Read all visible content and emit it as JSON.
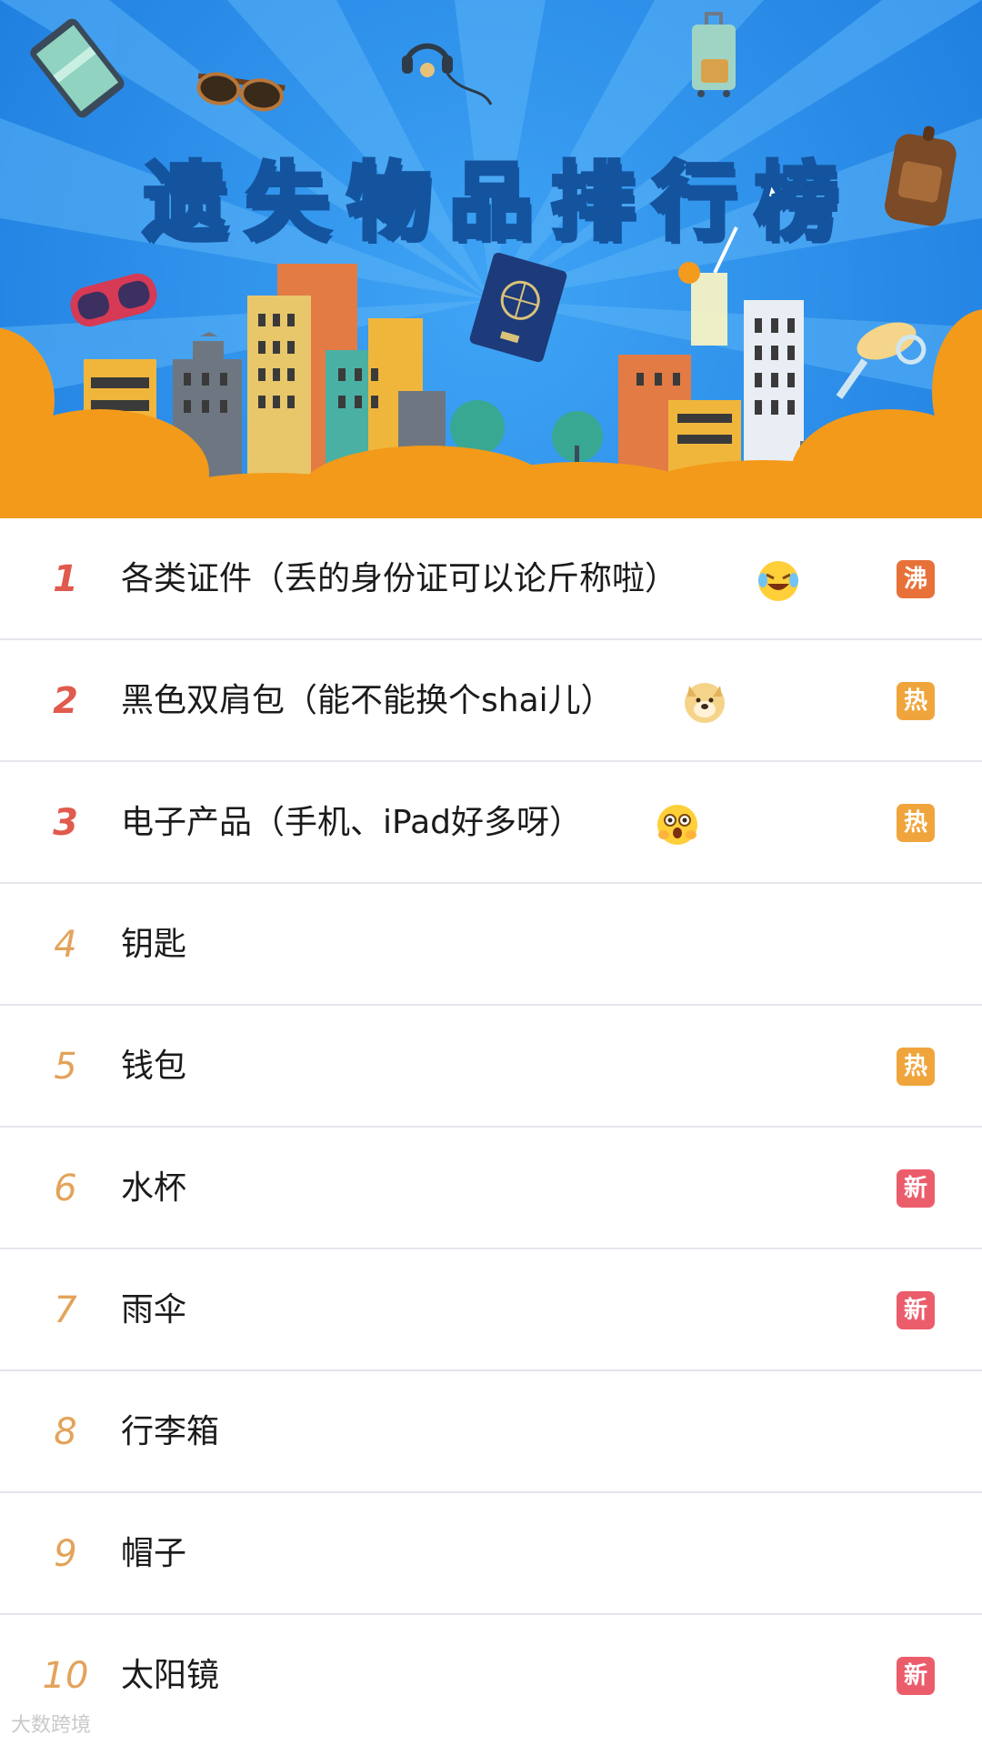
{
  "banner": {
    "title": "遗失物品排行榜"
  },
  "ranking": [
    {
      "rank": "1",
      "label": "各类证件（丢的身份证可以论斤称啦）",
      "emoji": "laughing-tears-emoji",
      "badge": "沸",
      "badge_color": "#e8713a"
    },
    {
      "rank": "2",
      "label": "黑色双肩包（能不能换个shai儿）",
      "emoji": "doge-emoji",
      "badge": "热",
      "badge_color": "#f0a53c"
    },
    {
      "rank": "3",
      "label": "电子产品（手机、iPad好多呀）",
      "emoji": "excited-face-emoji",
      "badge": "热",
      "badge_color": "#f0a53c"
    },
    {
      "rank": "4",
      "label": "钥匙",
      "emoji": "",
      "badge": "",
      "badge_color": ""
    },
    {
      "rank": "5",
      "label": "钱包",
      "emoji": "",
      "badge": "热",
      "badge_color": "#f0a53c"
    },
    {
      "rank": "6",
      "label": "水杯",
      "emoji": "",
      "badge": "新",
      "badge_color": "#ec5d6c"
    },
    {
      "rank": "7",
      "label": "雨伞",
      "emoji": "",
      "badge": "新",
      "badge_color": "#ec5d6c"
    },
    {
      "rank": "8",
      "label": "行李箱",
      "emoji": "",
      "badge": "",
      "badge_color": ""
    },
    {
      "rank": "9",
      "label": "帽子",
      "emoji": "",
      "badge": "",
      "badge_color": ""
    },
    {
      "rank": "10",
      "label": "太阳镜",
      "emoji": "",
      "badge": "新",
      "badge_color": "#ec5d6c"
    }
  ],
  "watermark": "大数跨境",
  "colors": {
    "banner_blue": "#2a8be8",
    "banner_orange": "#f39a1a",
    "rank_top": "#e05a4d",
    "rank_normal": "#e3a35a",
    "divider": "#e8e3ec"
  }
}
